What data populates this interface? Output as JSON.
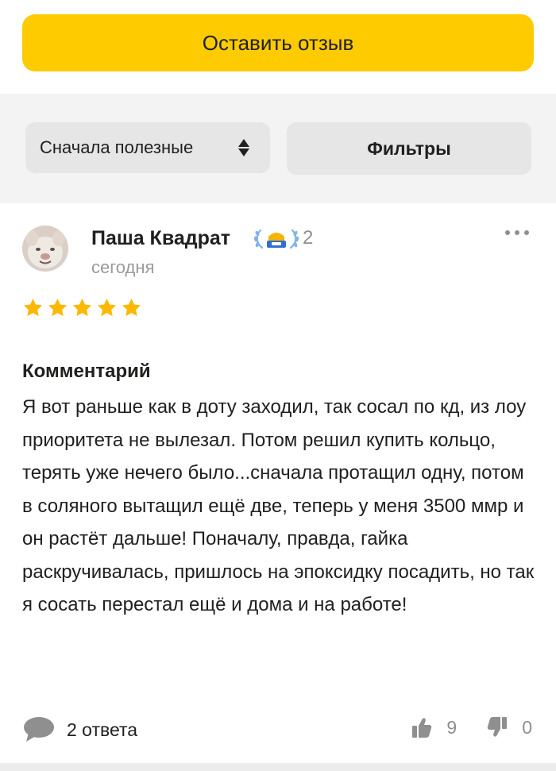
{
  "top": {
    "cta_label": "Оставить отзыв"
  },
  "controls": {
    "sort_label": "Сначала полезные",
    "filters_label": "Фильтры"
  },
  "review": {
    "author": "Паша Квадрат",
    "level": "2",
    "date": "сегодня",
    "rating": 5,
    "section_title": "Комментарий",
    "text": "Я вот раньше как в доту заходил, так сосал по кд, из лоу приоритета не вылезал. Потом решил купить кольцо, терять уже нечего было...сначала протащил одну, потом в соляного вытащил ещё две, теперь у меня 3500 ммр и он растёт дальше! Поначалу, правда, гайка раскручивалась, пришлось на эпоксидку посадить, но так я сосать перестал ещё и дома и на работе!",
    "replies_label": "2 ответа",
    "likes": "9",
    "dislikes": "0"
  },
  "icons": [
    "avatar",
    "laurel-badge-icon",
    "more-icon",
    "star-icon",
    "sort-arrows-icon",
    "comment-icon",
    "thumb-up-icon",
    "thumb-down-icon"
  ],
  "colors": {
    "accent": "#fdcb00",
    "star": "#ffb800",
    "badge": "#4a8cd6"
  }
}
